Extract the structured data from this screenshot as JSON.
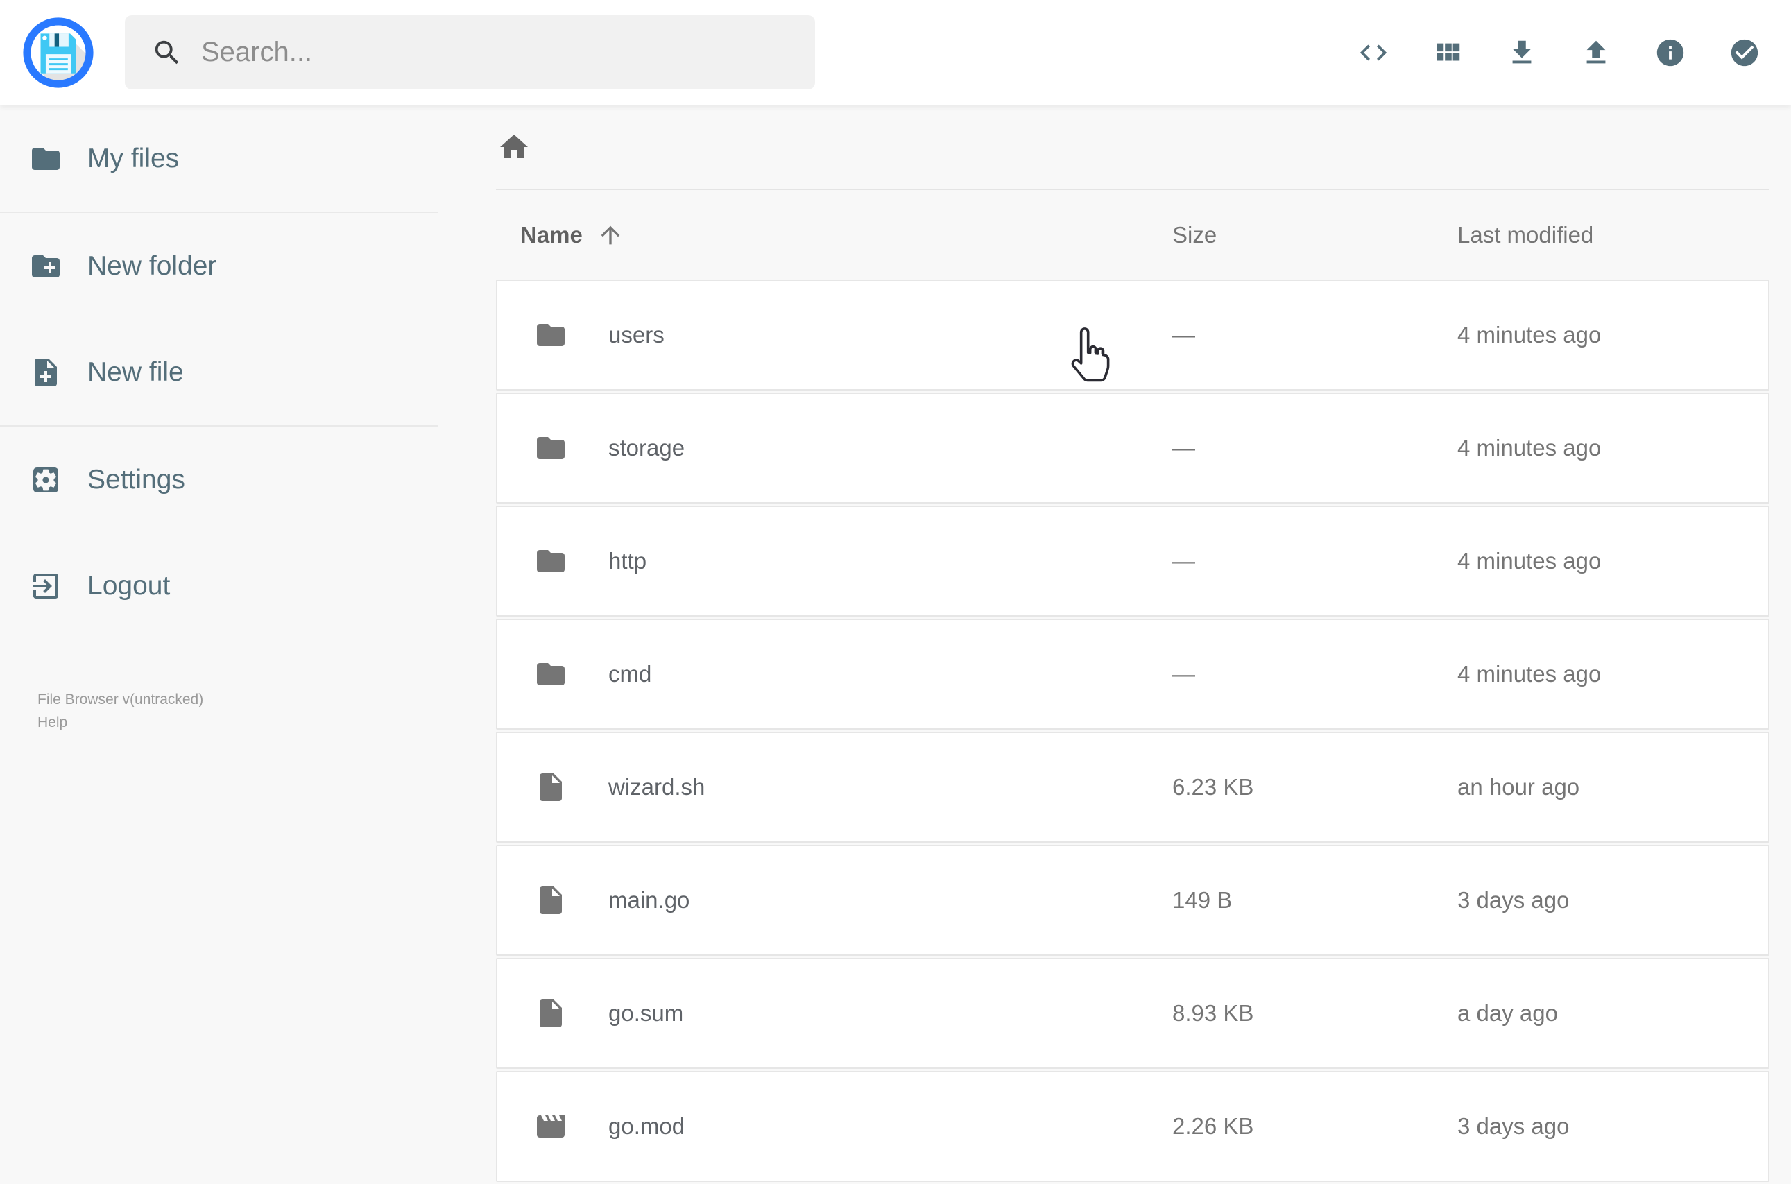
{
  "app": {
    "title": "File Browser"
  },
  "topbar": {
    "search": {
      "placeholder": "Search...",
      "icon": "search-icon"
    },
    "actions": [
      {
        "id": "shell-toggle-button",
        "icon": "code-icon"
      },
      {
        "id": "view-mode-button",
        "icon": "grid-icon"
      },
      {
        "id": "download-button",
        "icon": "download-icon"
      },
      {
        "id": "upload-button",
        "icon": "upload-icon"
      },
      {
        "id": "info-button",
        "icon": "info-icon"
      },
      {
        "id": "select-multiple-button",
        "icon": "check-circle-icon"
      }
    ]
  },
  "sidebar": {
    "groups": [
      {
        "items": [
          {
            "id": "my-files",
            "label": "My files",
            "icon": "folder-icon"
          }
        ]
      },
      {
        "items": [
          {
            "id": "new-folder",
            "label": "New folder",
            "icon": "new-folder-icon"
          },
          {
            "id": "new-file",
            "label": "New file",
            "icon": "new-file-icon"
          }
        ]
      },
      {
        "items": [
          {
            "id": "settings",
            "label": "Settings",
            "icon": "settings-icon"
          },
          {
            "id": "logout",
            "label": "Logout",
            "icon": "logout-icon"
          }
        ]
      }
    ],
    "footer": {
      "version": "File Browser v(untracked)",
      "help": "Help"
    }
  },
  "breadcrumb": {
    "home_icon": "home-icon"
  },
  "listing": {
    "columns": [
      {
        "id": "name",
        "label": "Name",
        "sorted": "asc",
        "sort_icon": "arrow-up-icon"
      },
      {
        "id": "size",
        "label": "Size"
      },
      {
        "id": "modified",
        "label": "Last modified"
      }
    ],
    "rows": [
      {
        "name": "users",
        "icon": "folder-icon",
        "size": "—",
        "modified": "4 minutes ago"
      },
      {
        "name": "storage",
        "icon": "folder-icon",
        "size": "—",
        "modified": "4 minutes ago"
      },
      {
        "name": "http",
        "icon": "folder-icon",
        "size": "—",
        "modified": "4 minutes ago"
      },
      {
        "name": "cmd",
        "icon": "folder-icon",
        "size": "—",
        "modified": "4 minutes ago"
      },
      {
        "name": "wizard.sh",
        "icon": "file-icon",
        "size": "6.23 KB",
        "modified": "an hour ago"
      },
      {
        "name": "main.go",
        "icon": "file-icon",
        "size": "149 B",
        "modified": "3 days ago"
      },
      {
        "name": "go.sum",
        "icon": "file-icon",
        "size": "8.93 KB",
        "modified": "a day ago"
      },
      {
        "name": "go.mod",
        "icon": "movie-icon",
        "size": "2.26 KB",
        "modified": "3 days ago"
      }
    ]
  },
  "colors": {
    "accent_blue": "#2979ff",
    "floppy_cyan": "#40c8f4",
    "slate": "#546e7a",
    "icon_gray": "#757575",
    "topbar_bg": "#ffffff",
    "page_bg": "#f8f8f8"
  },
  "cursor": {
    "type": "hand-pointer",
    "over_row": "users"
  }
}
